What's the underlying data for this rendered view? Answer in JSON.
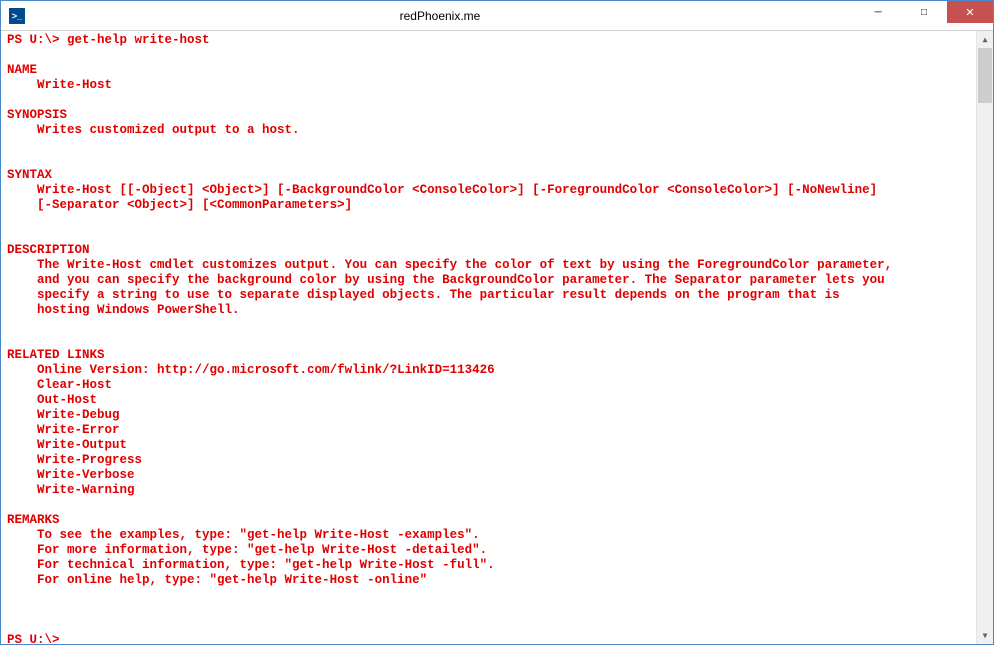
{
  "window": {
    "title": "redPhoenix.me",
    "icon_label": ">_"
  },
  "controls": {
    "minimize": "─",
    "maximize": "□",
    "close": "✕"
  },
  "console": {
    "prompt1": "PS U:\\> ",
    "command1": "get-help write-host",
    "name_header": "NAME",
    "name_value": "    Write-Host",
    "synopsis_header": "SYNOPSIS",
    "synopsis_value": "    Writes customized output to a host.",
    "syntax_header": "SYNTAX",
    "syntax_value": "    Write-Host [[-Object] <Object>] [-BackgroundColor <ConsoleColor>] [-ForegroundColor <ConsoleColor>] [-NoNewline]\n    [-Separator <Object>] [<CommonParameters>]",
    "description_header": "DESCRIPTION",
    "description_value": "    The Write-Host cmdlet customizes output. You can specify the color of text by using the ForegroundColor parameter,\n    and you can specify the background color by using the BackgroundColor parameter. The Separator parameter lets you\n    specify a string to use to separate displayed objects. The particular result depends on the program that is\n    hosting Windows PowerShell.",
    "related_header": "RELATED LINKS",
    "related_value": "    Online Version: http://go.microsoft.com/fwlink/?LinkID=113426\n    Clear-Host\n    Out-Host\n    Write-Debug\n    Write-Error\n    Write-Output\n    Write-Progress\n    Write-Verbose\n    Write-Warning",
    "remarks_header": "REMARKS",
    "remarks_value": "    To see the examples, type: \"get-help Write-Host -examples\".\n    For more information, type: \"get-help Write-Host -detailed\".\n    For technical information, type: \"get-help Write-Host -full\".\n    For online help, type: \"get-help Write-Host -online\"",
    "prompt2": "PS U:\\>"
  }
}
